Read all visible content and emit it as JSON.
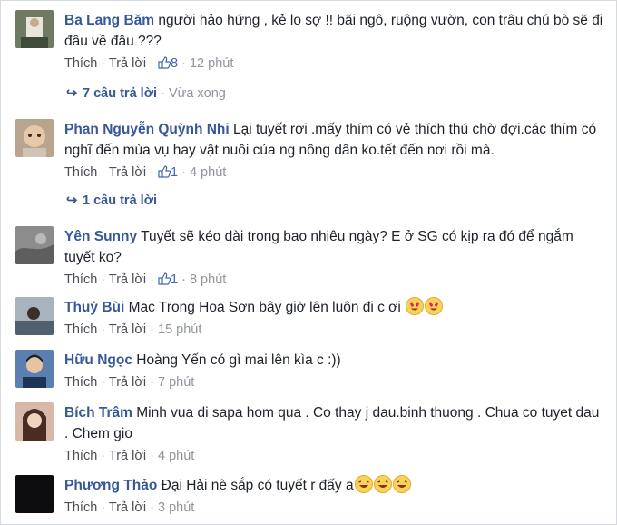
{
  "comments": [
    {
      "name": "Ba Lang Băm",
      "text": "người hảo hứng , kẻ lo sợ !! bãi ngô, ruộng vườn, con trâu chú bò sẽ đi đâu về đâu ???",
      "like_label": "Thích",
      "reply_label": "Trả lời",
      "likes": "8",
      "time": "12 phút",
      "replies": {
        "count_label": "7 câu trả lời",
        "time": "Vừa xong"
      }
    },
    {
      "name": "Phan Nguyễn Quỳnh Nhi",
      "text": "Lại tuyết rơi .mấy thím có vẻ thích thú chờ đợi.các thím có nghĩ đến mùa vụ hay vật nuôi của ng nông dân ko.tết đến nơi rồi mà.",
      "like_label": "Thích",
      "reply_label": "Trả lời",
      "likes": "1",
      "time": "4 phút",
      "replies": {
        "count_label": "1 câu trả lời"
      }
    },
    {
      "name": "Yên Sunny",
      "text": "Tuyết sẽ kéo dài trong bao nhiêu ngày? E ở SG có kịp ra đó để ngắm tuyết ko?",
      "like_label": "Thích",
      "reply_label": "Trả lời",
      "likes": "1",
      "time": "8 phút"
    },
    {
      "name": "Thuỷ Bùi",
      "text": "Mac Trong Hoa Sơn bây giờ lên luôn đi c ơi",
      "like_label": "Thích",
      "reply_label": "Trả lời",
      "time": "15 phút"
    },
    {
      "name": "Hữu Ngọc",
      "text": "Hoàng Yến có gì mai lên kìa c :))",
      "like_label": "Thích",
      "reply_label": "Trả lời",
      "time": "7 phút"
    },
    {
      "name": "Bích Trâm",
      "text": "Minh vua di sapa hom qua . Co thay j dau.binh thuong . Chua co tuyet dau . Chem gio",
      "like_label": "Thích",
      "reply_label": "Trả lời",
      "time": "4 phút"
    },
    {
      "name": "Phương Thảo",
      "text": "Đại Hải nè sắp có tuyết r đấy a",
      "like_label": "Thích",
      "reply_label": "Trả lời",
      "time": "3 phút"
    }
  ],
  "colors": {
    "name": "#365899",
    "meta": "#90949c",
    "text": "#1d2129"
  }
}
